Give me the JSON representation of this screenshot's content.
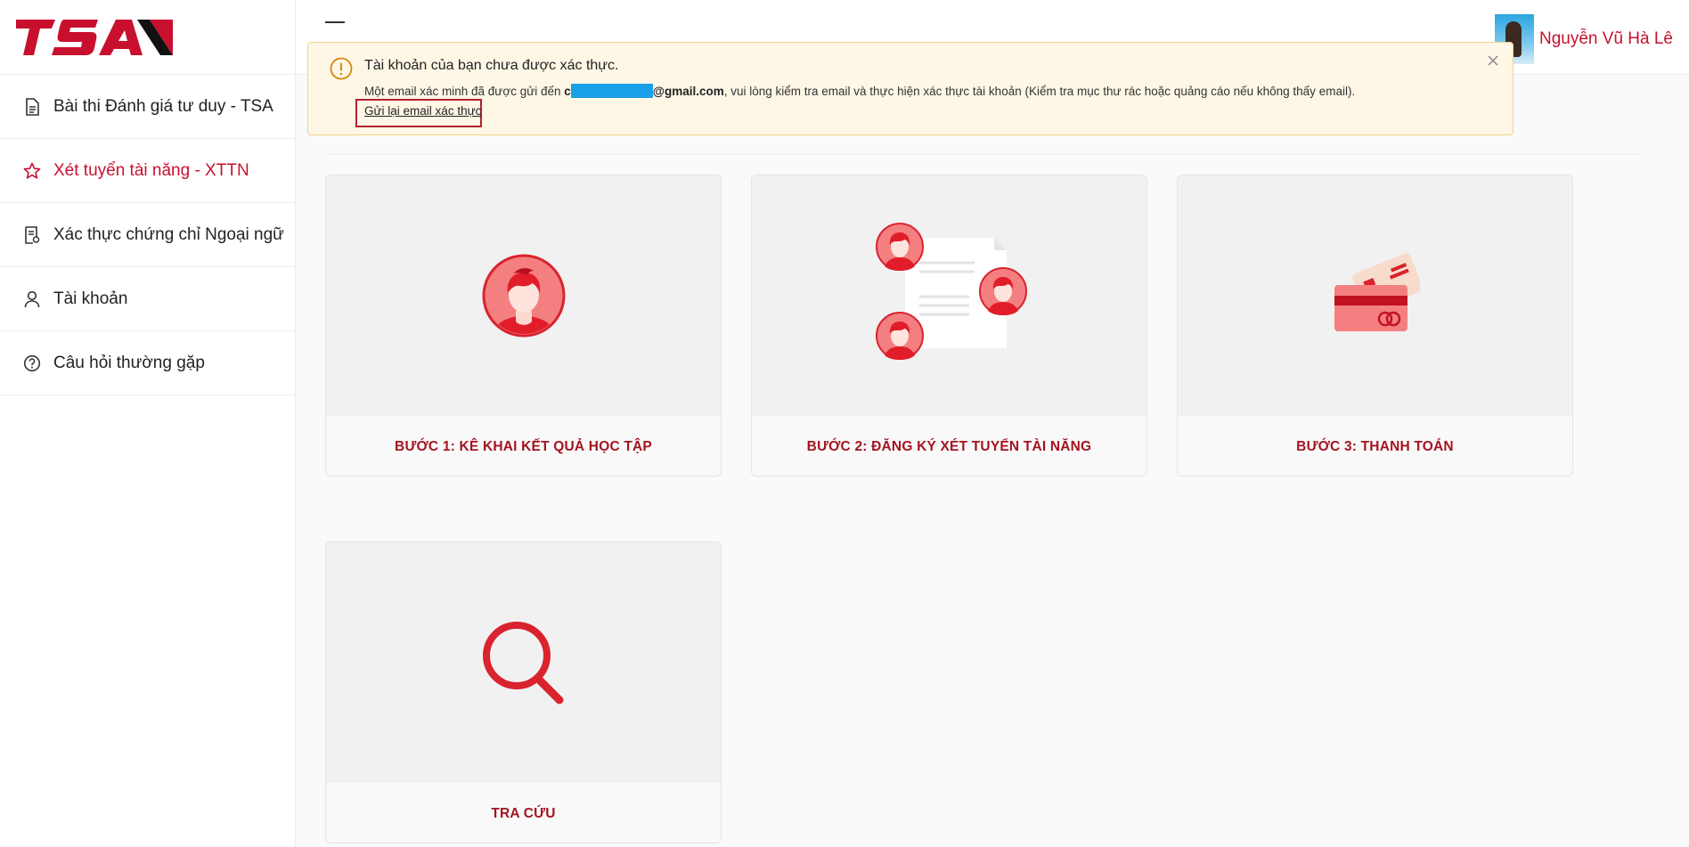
{
  "brand": {
    "logo_text": "TSA",
    "accent": "#c8102e"
  },
  "sidebar": {
    "items": [
      {
        "label": "Bài thi Đánh giá tư duy - TSA",
        "icon": "document-icon",
        "active": false
      },
      {
        "label": "Xét tuyển tài năng - XTTN",
        "icon": "star-icon",
        "active": true
      },
      {
        "label": "Xác thực chứng chỉ Ngoại ngữ",
        "icon": "certificate-icon",
        "active": false
      },
      {
        "label": "Tài khoản",
        "icon": "user-icon",
        "active": false
      },
      {
        "label": "Câu hỏi thường gặp",
        "icon": "question-circle-icon",
        "active": false
      }
    ]
  },
  "header": {
    "user_name": "Nguyễn Vũ Hà Lê"
  },
  "alert": {
    "title": "Tài khoản của bạn chưa được xác thực.",
    "message_prefix": "Một email xác minh đã được gửi đến ",
    "email_start": "c",
    "email_domain": "@gmail.com",
    "message_suffix": ", vui lòng kiểm tra email và thực hiện xác thực tài khoản (Kiểm tra mục thư rác hoặc quảng cáo nếu không thấy email).",
    "resend_label": "Gửi lại email xác thực"
  },
  "cards": [
    {
      "label": "BƯỚC 1: KÊ KHAI KẾT QUẢ HỌC TẬP",
      "icon": "profile-avatar-icon"
    },
    {
      "label": "BƯỚC 2: ĐĂNG KÝ XÉT TUYỂN TÀI NĂNG",
      "icon": "group-document-icon"
    },
    {
      "label": "BƯỚC 3: THANH TOÁN",
      "icon": "credit-card-icon"
    },
    {
      "label": "TRA CỨU",
      "icon": "search-icon"
    }
  ]
}
